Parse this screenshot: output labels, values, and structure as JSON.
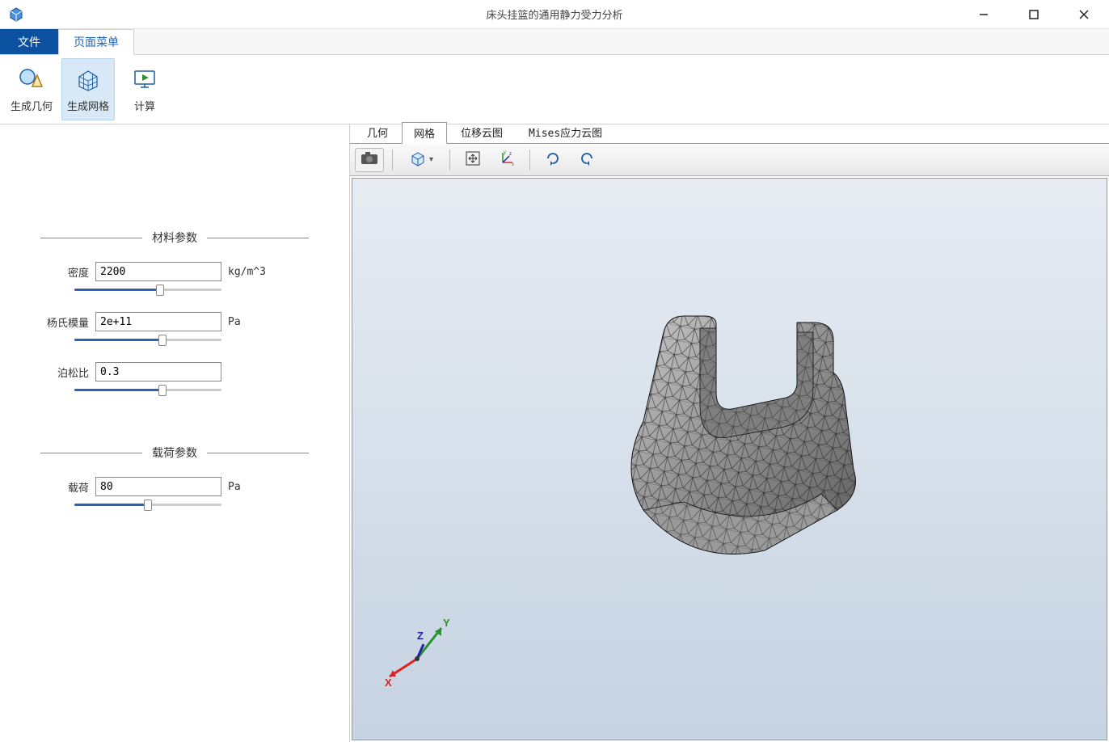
{
  "app": {
    "title": "床头挂篮的通用静力受力分析"
  },
  "ribbon": {
    "tabs": {
      "file": "文件",
      "page_menu": "页面菜单"
    },
    "items": {
      "gen_geometry": "生成几何",
      "gen_mesh": "生成网格",
      "compute": "计算"
    }
  },
  "sidepanel": {
    "material": {
      "title": "材料参数",
      "density": {
        "label": "密度",
        "value": "2200",
        "unit": "kg/m^3",
        "fill": 58
      },
      "youngs": {
        "label": "杨氏模量",
        "value": "2e+11",
        "unit": "Pa",
        "fill": 60
      },
      "poisson": {
        "label": "泊松比",
        "value": "0.3",
        "unit": "",
        "fill": 60
      }
    },
    "load": {
      "title": "载荷参数",
      "load": {
        "label": "载荷",
        "value": "80",
        "unit": "Pa",
        "fill": 50
      }
    }
  },
  "view": {
    "tabs": {
      "geometry": "几何",
      "mesh": "网格",
      "disp": "位移云图",
      "mises": "Mises应力云图"
    },
    "triad": {
      "x": "X",
      "y": "Y",
      "z": "Z"
    }
  }
}
